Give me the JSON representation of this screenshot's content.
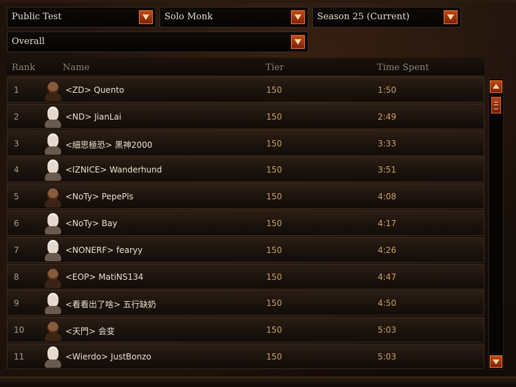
{
  "filters": {
    "region": "Public Test",
    "category": "Solo Monk",
    "season": "Season 25 (Current)",
    "board": "Overall"
  },
  "columns": {
    "rank": "Rank",
    "name": "Name",
    "tier": "Tier",
    "time": "Time Spent"
  },
  "rows": [
    {
      "rank": "1",
      "name": "<ZD> Quento",
      "tier": "150",
      "time": "1:50",
      "portrait": "dark"
    },
    {
      "rank": "2",
      "name": "<ND> JianLai",
      "tier": "150",
      "time": "2:49",
      "portrait": "light"
    },
    {
      "rank": "3",
      "name": "<細思極恐> 黑神2000",
      "tier": "150",
      "time": "3:33",
      "portrait": "light"
    },
    {
      "rank": "4",
      "name": "<IZNICE> Wanderhund",
      "tier": "150",
      "time": "3:51",
      "portrait": "light"
    },
    {
      "rank": "5",
      "name": "<NoTy> PepePls",
      "tier": "150",
      "time": "4:08",
      "portrait": "dark"
    },
    {
      "rank": "6",
      "name": "<NoTy> Bay",
      "tier": "150",
      "time": "4:17",
      "portrait": "light"
    },
    {
      "rank": "7",
      "name": "<NONERF> fearyy",
      "tier": "150",
      "time": "4:26",
      "portrait": "light"
    },
    {
      "rank": "8",
      "name": "<EOP> MatiNS134",
      "tier": "150",
      "time": "4:47",
      "portrait": "dark"
    },
    {
      "rank": "9",
      "name": "<看看出了啥> 五行缺奶",
      "tier": "150",
      "time": "4:50",
      "portrait": "light"
    },
    {
      "rank": "10",
      "name": "<天門> 会变",
      "tier": "150",
      "time": "5:03",
      "portrait": "dark"
    },
    {
      "rank": "11",
      "name": "<Wierdo> JustBonzo",
      "tier": "150",
      "time": "5:03",
      "portrait": "light"
    }
  ],
  "colors": {
    "accent": "#c24a16",
    "time_text": "#c9a26a",
    "name_text": "#e9e2d2"
  }
}
